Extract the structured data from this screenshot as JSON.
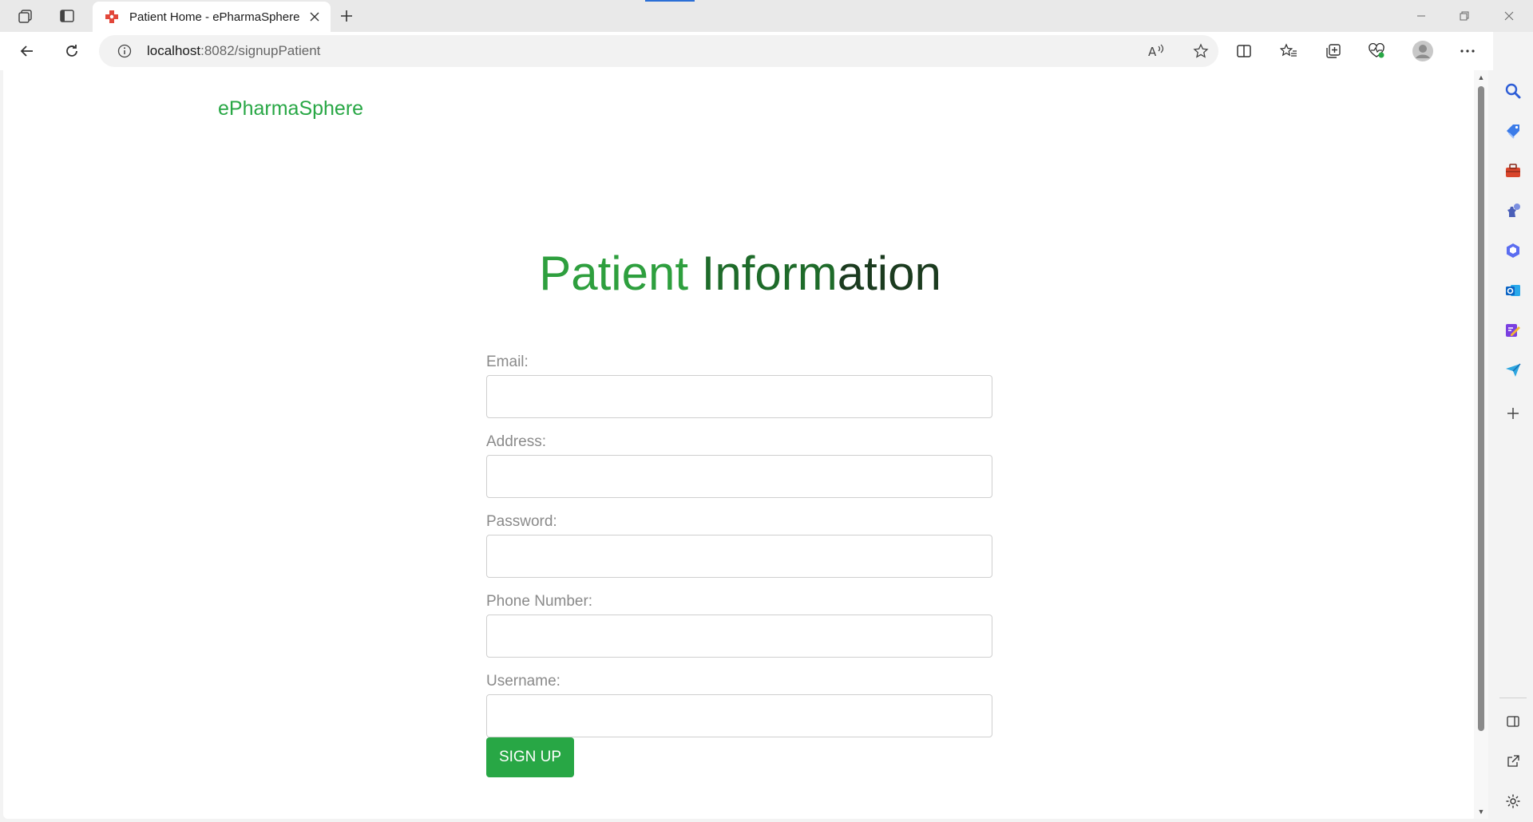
{
  "browser": {
    "tab": {
      "title": "Patient Home - ePharmaSphere"
    },
    "address": {
      "host": "localhost",
      "path": ":8082/signupPatient"
    },
    "icons": {
      "workspaces": "workspaces-icon",
      "tab_actions": "tab-actions-icon",
      "new_tab": "plus-icon",
      "back": "back-arrow-icon",
      "refresh": "refresh-icon",
      "info": "info-icon",
      "read_aloud": "read-aloud-icon",
      "favorite": "star-icon",
      "split_screen": "split-screen-icon",
      "favorites": "favorites-icon",
      "collections": "collections-icon",
      "browser_essentials": "heart-pulse-icon",
      "profile": "profile-icon",
      "more": "more-icon",
      "copilot": "copilot-icon"
    },
    "colors": {
      "accent": "#28a745",
      "loading": "#2b6fd6"
    }
  },
  "sidebar": {
    "items": [
      "search-icon",
      "shopping-tag-icon",
      "toolbox-icon",
      "games-icon",
      "copilot-apps-icon",
      "outlook-icon",
      "designer-icon",
      "send-icon",
      "add-icon"
    ],
    "bottom": [
      "sidebar-toggle-icon",
      "external-link-icon",
      "settings-icon"
    ]
  },
  "page": {
    "brand": "ePharmaSphere",
    "heading": {
      "part_a": "Patient ",
      "part_b": "Inform",
      "part_c": "ation"
    },
    "form": {
      "email_label": "Email:",
      "address_label": "Address:",
      "password_label": "Password:",
      "phone_label": "Phone Number:",
      "username_label": "Username:",
      "email_value": "",
      "address_value": "",
      "password_value": "",
      "phone_value": "",
      "username_value": "",
      "submit_label": "SIGN UP"
    }
  }
}
